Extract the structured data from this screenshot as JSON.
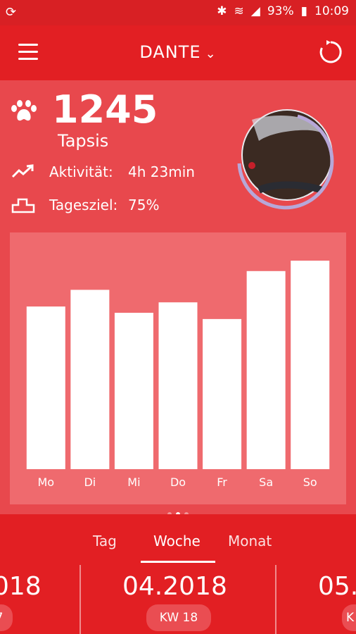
{
  "status": {
    "left_icon": "sync-icon",
    "battery": "93%",
    "time": "10:09"
  },
  "header": {
    "title": "DANTE"
  },
  "summary": {
    "steps": "1245",
    "steps_unit": "Tapsis",
    "activity_label": "Aktivität:",
    "activity_value": "4h 23min",
    "goal_label": "Tagesziel:",
    "goal_value": "75%"
  },
  "colors": {
    "primary": "#e21f23",
    "panel": "#ef6a6e",
    "ring": "#b7a7d8"
  },
  "chart_data": {
    "type": "bar",
    "categories": [
      "Mo",
      "Di",
      "Mi",
      "Do",
      "Fr",
      "Sa",
      "So"
    ],
    "values": [
      78,
      86,
      75,
      80,
      72,
      95,
      100
    ],
    "ylim": [
      0,
      100
    ],
    "grid": false
  },
  "pager": {
    "active_index": 1,
    "count": 3
  },
  "tabs": [
    "Tag",
    "Woche",
    "Monat"
  ],
  "active_tab": "Woche",
  "periods": {
    "left": {
      "label": "018",
      "week": "7"
    },
    "center": {
      "label": "04.2018",
      "week": "KW 18"
    },
    "right": {
      "label": "05.",
      "week": "K"
    }
  }
}
